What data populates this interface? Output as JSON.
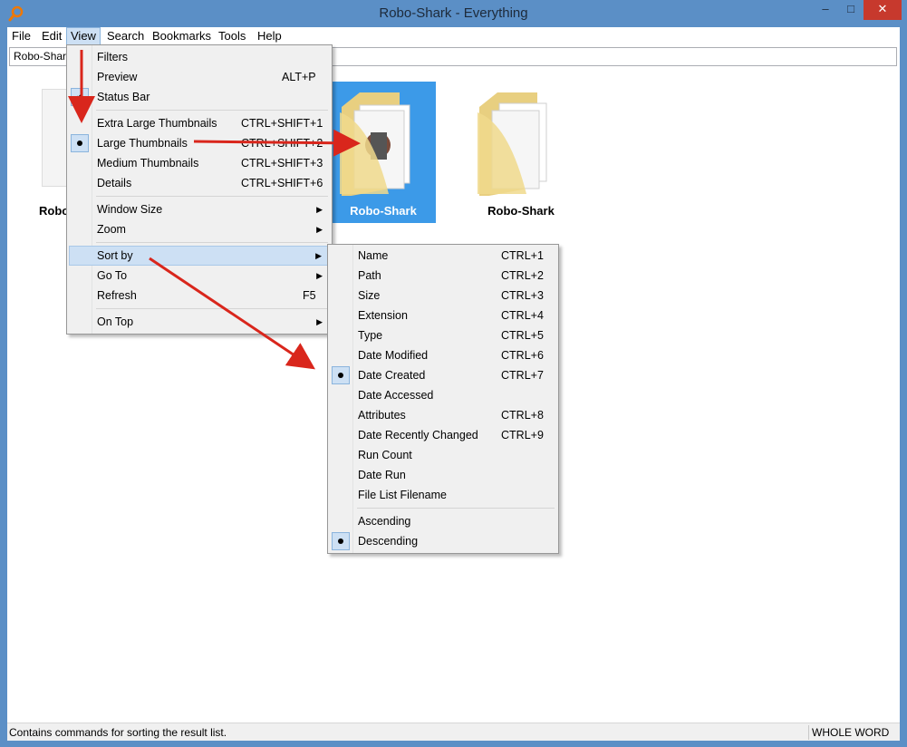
{
  "window": {
    "title": "Robo-Shark - Everything"
  },
  "menubar": {
    "items": [
      "File",
      "Edit",
      "View",
      "Search",
      "Bookmarks",
      "Tools",
      "Help"
    ]
  },
  "search": {
    "value": "Robo-Shark"
  },
  "results": {
    "labels": [
      "Robo-Shark",
      "Robo-Shark",
      "Robo-Shark"
    ],
    "first_label_partial": "Robo"
  },
  "view_menu": {
    "filters": "Filters",
    "preview": "Preview",
    "preview_sc": "ALT+P",
    "status_bar": "Status Bar",
    "xl_thumbs": "Extra Large Thumbnails",
    "xl_thumbs_sc": "CTRL+SHIFT+1",
    "large_thumbs": "Large Thumbnails",
    "large_thumbs_sc": "CTRL+SHIFT+2",
    "medium_thumbs": "Medium Thumbnails",
    "medium_thumbs_sc": "CTRL+SHIFT+3",
    "details": "Details",
    "details_sc": "CTRL+SHIFT+6",
    "window_size": "Window Size",
    "zoom": "Zoom",
    "sort_by": "Sort by",
    "go_to": "Go To",
    "refresh": "Refresh",
    "refresh_sc": "F5",
    "on_top": "On Top"
  },
  "sort_menu": {
    "name": "Name",
    "name_sc": "CTRL+1",
    "path": "Path",
    "path_sc": "CTRL+2",
    "size": "Size",
    "size_sc": "CTRL+3",
    "extension": "Extension",
    "extension_sc": "CTRL+4",
    "type": "Type",
    "type_sc": "CTRL+5",
    "date_modified": "Date Modified",
    "date_modified_sc": "CTRL+6",
    "date_created": "Date Created",
    "date_created_sc": "CTRL+7",
    "date_accessed": "Date Accessed",
    "attributes": "Attributes",
    "attributes_sc": "CTRL+8",
    "date_recently_changed": "Date Recently Changed",
    "date_recently_changed_sc": "CTRL+9",
    "run_count": "Run Count",
    "date_run": "Date Run",
    "file_list_filename": "File List Filename",
    "ascending": "Ascending",
    "descending": "Descending"
  },
  "status": {
    "text": "Contains commands for sorting the result list.",
    "mode": "WHOLE WORD"
  },
  "colors": {
    "titlebar": "#5b8fc6",
    "selection": "#3c9ae8",
    "menu_highlight": "#cde0f4",
    "arrow": "#d9261c",
    "close_button": "#c7392d"
  },
  "icons": [
    "search-app-icon",
    "folder-icon",
    "checkmark-icon",
    "radio-dot-icon",
    "submenu-arrow-icon",
    "minimize-icon",
    "maximize-icon",
    "close-icon"
  ]
}
